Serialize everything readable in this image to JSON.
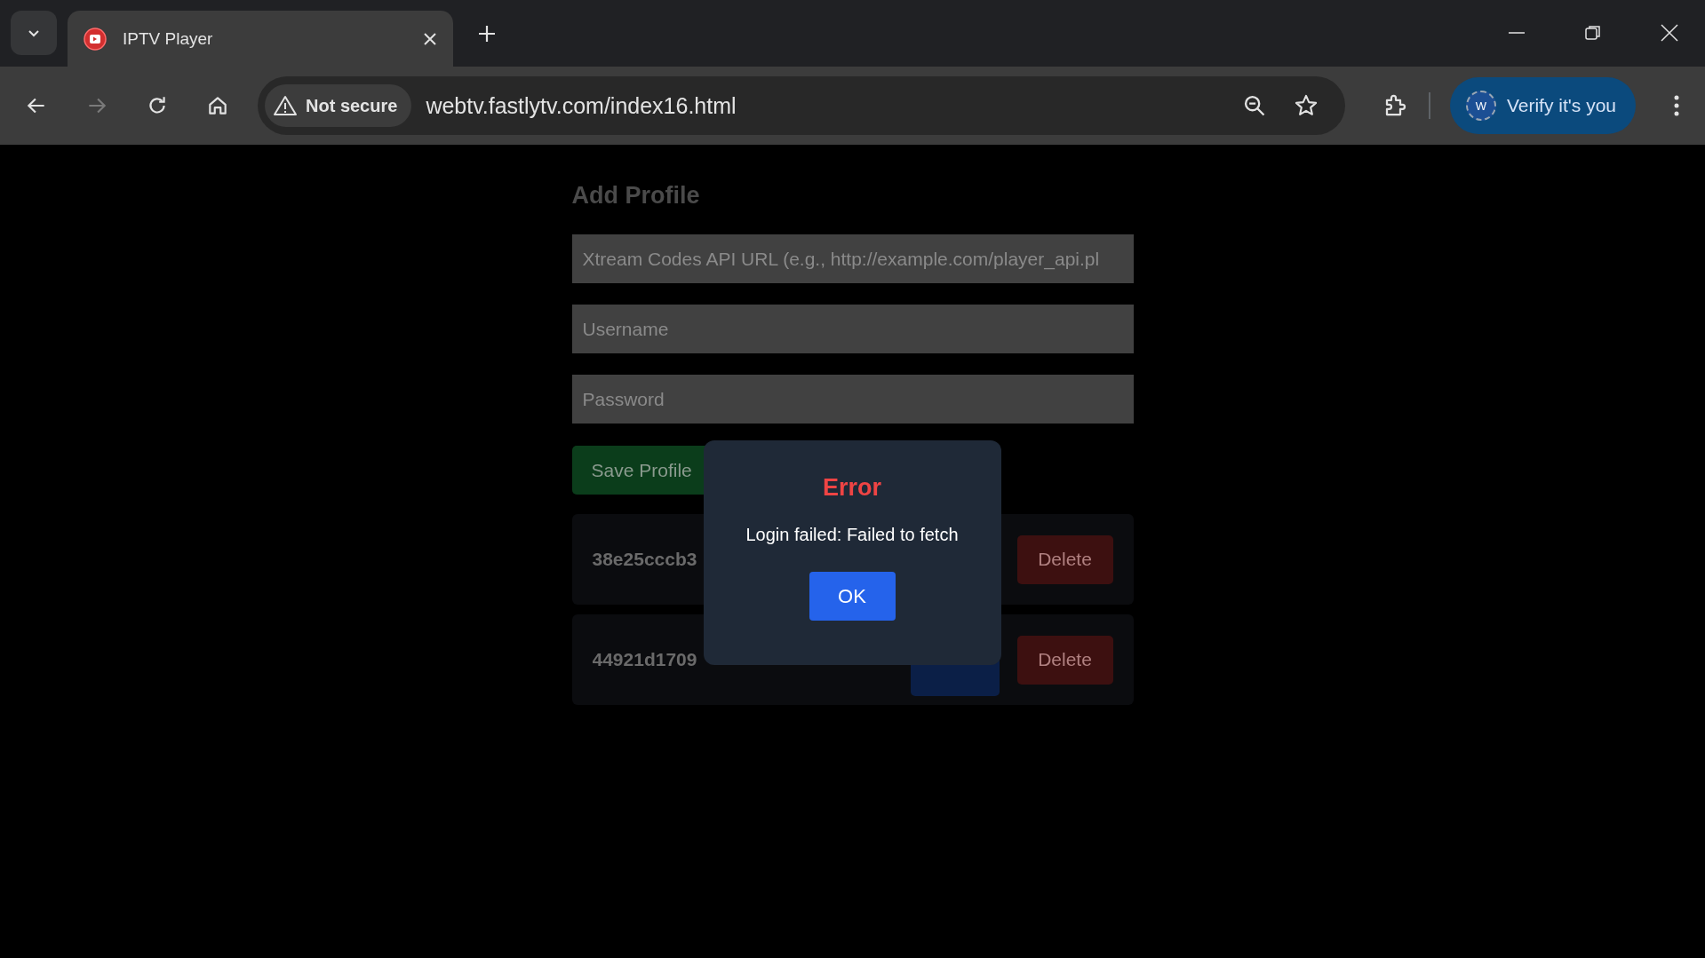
{
  "browser": {
    "tab": {
      "title": "IPTV Player",
      "selected": true
    },
    "security": "Not secure",
    "url": "webtv.fastlytv.com/index16.html",
    "profile_button": {
      "initial": "W",
      "label": "Verify it's you"
    }
  },
  "page": {
    "heading": "Add Profile",
    "fields": [
      {
        "placeholder": "Xtream Codes API URL (e.g., http://example.com/player_api.pl"
      },
      {
        "placeholder": "Username"
      },
      {
        "placeholder": "Password"
      }
    ],
    "save_button": "Save Profile",
    "profiles": [
      {
        "name": "38e25cccb3",
        "delete": "Delete"
      },
      {
        "name": "44921d1709",
        "login_visible": true,
        "delete": "Delete"
      }
    ]
  },
  "dialog": {
    "title": "Error",
    "message": "Login failed: Failed to fetch",
    "button": "OK"
  }
}
